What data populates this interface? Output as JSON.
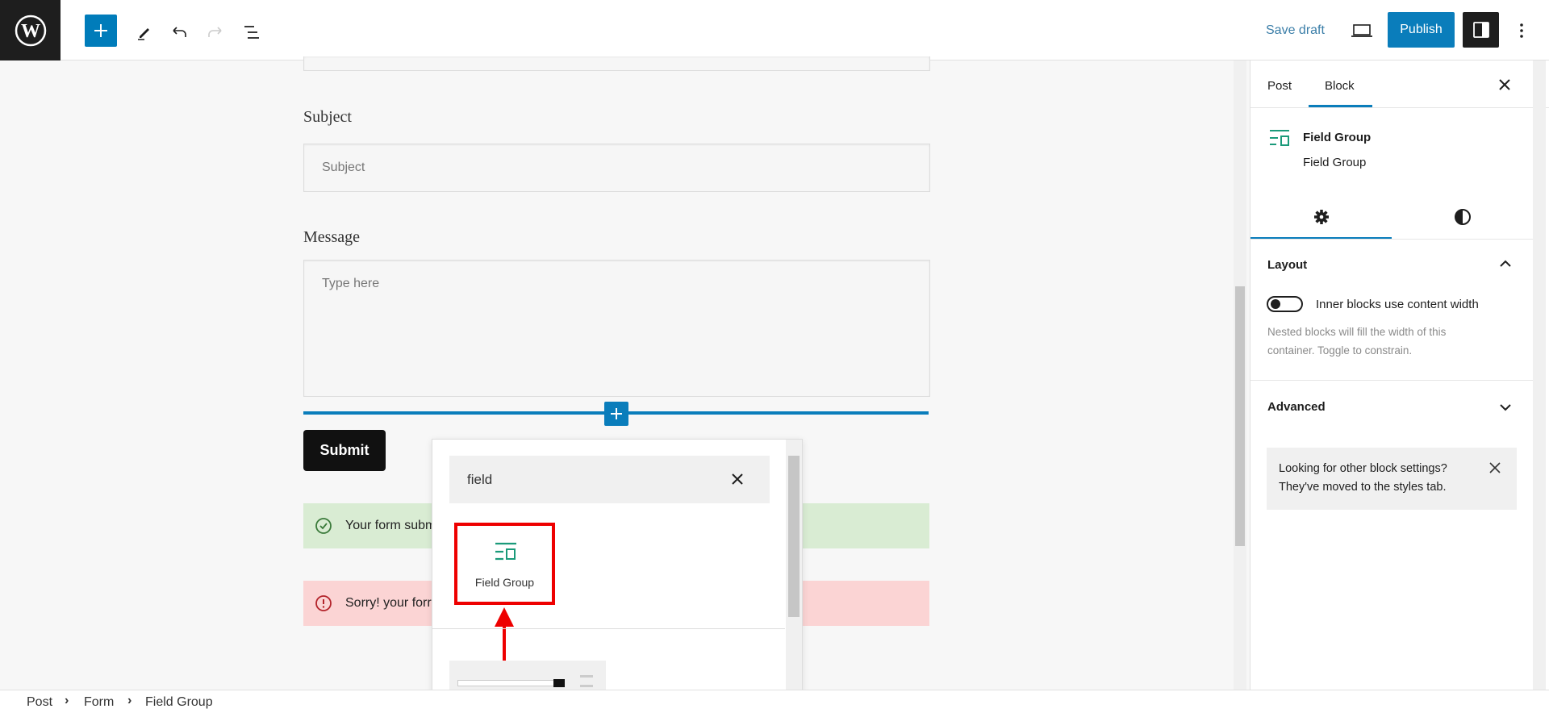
{
  "toolbar": {
    "logo": "wordpress-logo",
    "save_draft": "Save draft",
    "publish": "Publish",
    "accent_color": "#007cba"
  },
  "form": {
    "subject_label": "Subject",
    "subject_placeholder": "Subject",
    "message_label": "Message",
    "message_placeholder": "Type here",
    "submit": "Submit",
    "success_text": "Your form subm",
    "error_text": "Sorry! your forr"
  },
  "inserter": {
    "search_value": "field",
    "result_label": "Field Group"
  },
  "sidebar": {
    "tabs": [
      {
        "label": "Post"
      },
      {
        "label": "Block"
      }
    ],
    "active_tab": "Block",
    "block_title": "Field Group",
    "block_description": "Field Group",
    "layout_title": "Layout",
    "toggle_label": "Inner blocks use content width",
    "toggle_on": false,
    "help_text": "Nested blocks will fill the width of this container. Toggle to constrain.",
    "advanced_title": "Advanced",
    "notice_text": "Looking for other block settings? They've moved to the styles tab."
  },
  "breadcrumbs": [
    {
      "label": "Post"
    },
    {
      "label": "Form"
    },
    {
      "label": "Field Group"
    }
  ]
}
